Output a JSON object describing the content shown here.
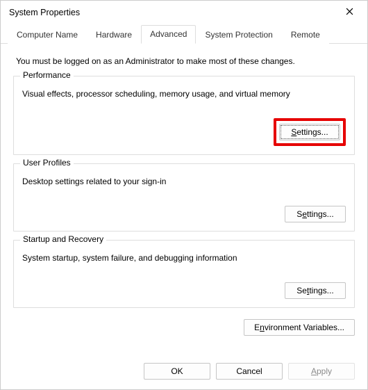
{
  "window": {
    "title": "System Properties"
  },
  "tabs": {
    "items": [
      {
        "label": "Computer Name"
      },
      {
        "label": "Hardware"
      },
      {
        "label": "Advanced"
      },
      {
        "label": "System Protection"
      },
      {
        "label": "Remote"
      }
    ],
    "activeIndex": 2
  },
  "content": {
    "intro": "You must be logged on as an Administrator to make most of these changes.",
    "groups": {
      "performance": {
        "legend": "Performance",
        "desc": "Visual effects, processor scheduling, memory usage, and virtual memory",
        "button": "Settings..."
      },
      "userProfiles": {
        "legend": "User Profiles",
        "desc": "Desktop settings related to your sign-in",
        "button": "Settings..."
      },
      "startup": {
        "legend": "Startup and Recovery",
        "desc": "System startup, system failure, and debugging information",
        "button": "Settings..."
      }
    },
    "envButton": "Environment Variables..."
  },
  "footer": {
    "ok": "OK",
    "cancel": "Cancel",
    "apply": "Apply"
  }
}
